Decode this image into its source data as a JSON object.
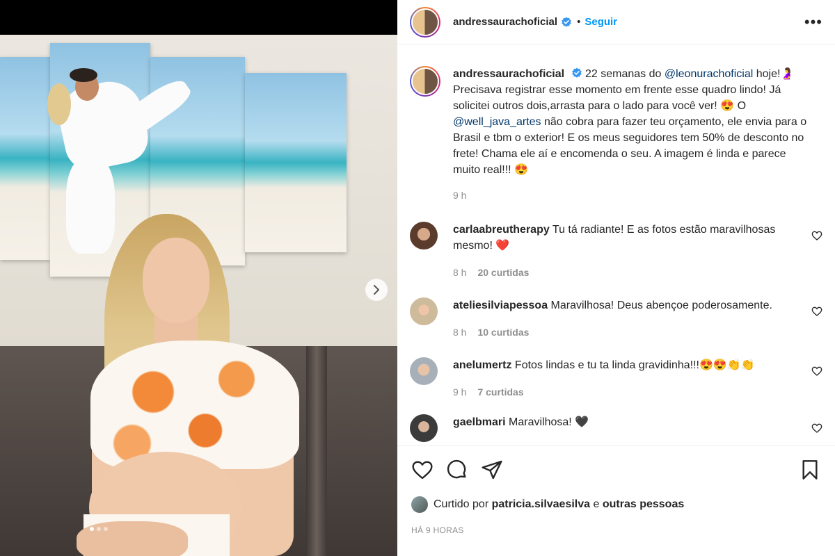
{
  "header": {
    "username": "andressaurachoficial",
    "bullet": "•",
    "follow_label": "Seguir",
    "more_label": "•••"
  },
  "caption": {
    "username": "andressaurachoficial",
    "text_1": "22 semanas do ",
    "mention_1": "@leonurachoficial",
    "text_2": " hoje!🤰 Precisava registrar esse momento em frente esse quadro lindo! Já solicitei outros dois,arrasta para o lado para você ver! 😍 O ",
    "mention_2": "@well_java_artes",
    "text_3": " não cobra para fazer teu orçamento, ele envia para o Brasil e tbm o exterior! E os meus seguidores tem 50% de desconto no frete! Chama ele aí e encomenda o seu. A imagem é linda e parece muito real!!! 😍",
    "time": "9 h"
  },
  "comments": [
    {
      "username": "carlaabreutherapy",
      "text": "Tu tá radiante! E as fotos estão maravilhosas mesmo! ❤️",
      "time": "8 h",
      "likes": "20 curtidas",
      "avatar_color": "#6b4a3a"
    },
    {
      "username": "ateliesilviapessoa",
      "text": "Maravilhosa! Deus abençoe poderosamente.",
      "time": "8 h",
      "likes": "10 curtidas",
      "avatar_color": "#c9b89a"
    },
    {
      "username": "anelumertz",
      "text": "Fotos lindas e tu ta linda gravidinha!!!😍😍👏👏",
      "time": "9 h",
      "likes": "7 curtidas",
      "avatar_color": "#9aa3ab"
    },
    {
      "username": "gaelbmari",
      "text": "Maravilhosa! 🖤",
      "time": "",
      "likes": "",
      "avatar_color": "#3b3b3b"
    }
  ],
  "likes": {
    "prefix": "Curtido por ",
    "user": "patricia.silvaesilva",
    "middle": " e ",
    "suffix": "outras pessoas"
  },
  "timestamp": "HÁ 9 HORAS",
  "colors": {
    "link_blue": "#0095f6",
    "mention": "#00376b",
    "meta_gray": "#8e8e8e",
    "verified": "#3897f0"
  },
  "carousel": {
    "total": 3,
    "active": 1
  }
}
